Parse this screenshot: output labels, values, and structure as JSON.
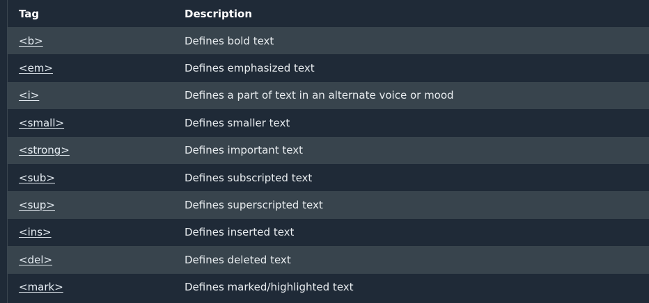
{
  "table": {
    "headers": {
      "tag": "Tag",
      "description": "Description"
    },
    "rows": [
      {
        "tag": "<b>",
        "description": "Defines bold text"
      },
      {
        "tag": "<em>",
        "description": "Defines emphasized text"
      },
      {
        "tag": "<i>",
        "description": "Defines a part of text in an alternate voice or mood"
      },
      {
        "tag": "<small>",
        "description": "Defines smaller text"
      },
      {
        "tag": "<strong>",
        "description": "Defines important text"
      },
      {
        "tag": "<sub>",
        "description": "Defines subscripted text"
      },
      {
        "tag": "<sup>",
        "description": "Defines superscripted text"
      },
      {
        "tag": "<ins>",
        "description": "Defines inserted text"
      },
      {
        "tag": "<del>",
        "description": "Defines deleted text"
      },
      {
        "tag": "<mark>",
        "description": "Defines marked/highlighted text"
      }
    ]
  },
  "colors": {
    "background": "#1f2a37",
    "row_alt": "#38444d",
    "text": "#e8ecef"
  }
}
